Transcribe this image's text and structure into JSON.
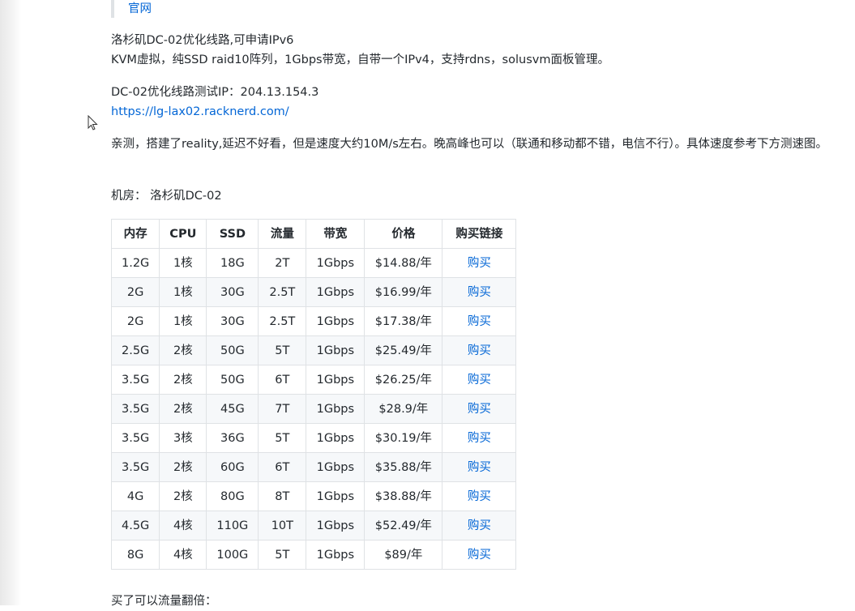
{
  "official_link": "官网",
  "intro": {
    "line1": "洛杉矶DC-02优化线路,可申请IPv6",
    "line2": "KVM虚拟，纯SSD raid10阵列，1Gbps带宽，自带一个IPv4，支持rdns，solusvm面板管理。"
  },
  "test": {
    "ip_line": "DC-02优化线路测试IP：204.13.154.3",
    "url": "https://lg-lax02.racknerd.com/"
  },
  "review": "亲测，搭建了reality,延迟不好看，但是速度大约10M/s左右。晚高峰也可以（联通和移动都不错，电信不行）。具体速度参考下方测速图。",
  "datacenter": "机房： 洛杉矶DC-02",
  "table": {
    "headers": [
      "内存",
      "CPU",
      "SSD",
      "流量",
      "带宽",
      "价格",
      "购买链接"
    ],
    "rows": [
      [
        "1.2G",
        "1核",
        "18G",
        "2T",
        "1Gbps",
        "$14.88/年",
        "购买"
      ],
      [
        "2G",
        "1核",
        "30G",
        "2.5T",
        "1Gbps",
        "$16.99/年",
        "购买"
      ],
      [
        "2G",
        "1核",
        "30G",
        "2.5T",
        "1Gbps",
        "$17.38/年",
        "购买"
      ],
      [
        "2.5G",
        "2核",
        "50G",
        "5T",
        "1Gbps",
        "$25.49/年",
        "购买"
      ],
      [
        "3.5G",
        "2核",
        "50G",
        "6T",
        "1Gbps",
        "$26.25/年",
        "购买"
      ],
      [
        "3.5G",
        "2核",
        "45G",
        "7T",
        "1Gbps",
        "$28.9/年",
        "购买"
      ],
      [
        "3.5G",
        "3核",
        "36G",
        "5T",
        "1Gbps",
        "$30.19/年",
        "购买"
      ],
      [
        "3.5G",
        "2核",
        "60G",
        "6T",
        "1Gbps",
        "$35.88/年",
        "购买"
      ],
      [
        "4G",
        "2核",
        "80G",
        "8T",
        "1Gbps",
        "$38.88/年",
        "购买"
      ],
      [
        "4.5G",
        "4核",
        "110G",
        "10T",
        "1Gbps",
        "$52.49/年",
        "购买"
      ],
      [
        "8G",
        "4核",
        "100G",
        "5T",
        "1Gbps",
        "$89/年",
        "购买"
      ]
    ]
  },
  "footer_text": "买了可以流量翻倍："
}
